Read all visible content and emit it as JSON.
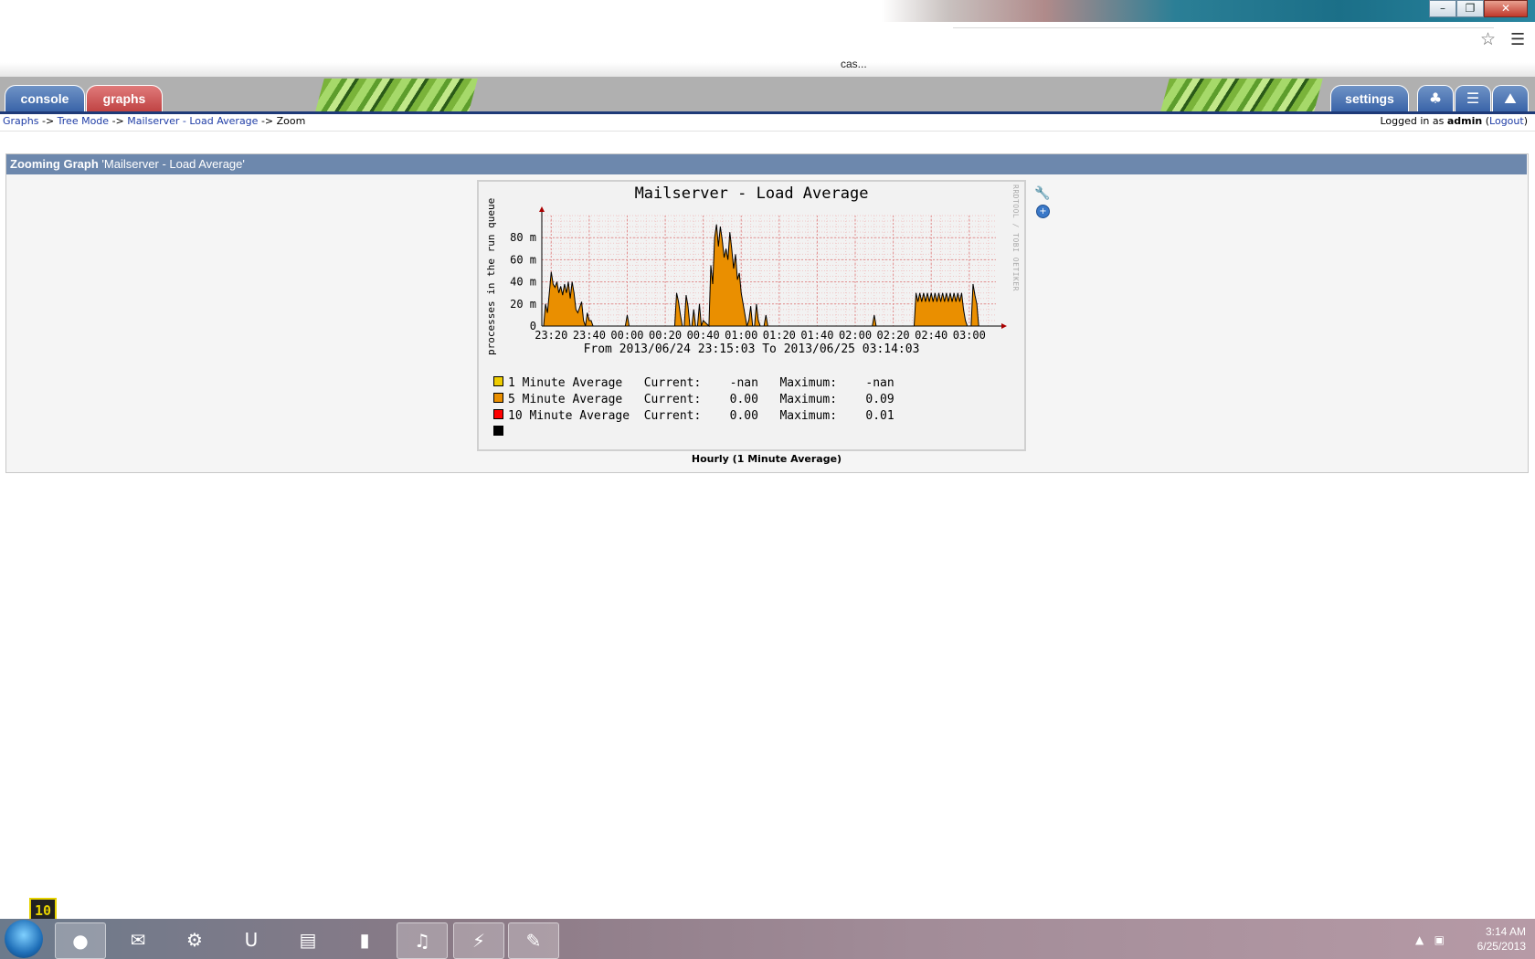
{
  "browser": {
    "tab_text": "cas...",
    "star_icon": "star-icon",
    "menu_icon": "hamburger-menu-icon",
    "window_controls": {
      "minimize": "–",
      "restore": "❐",
      "close": "✕"
    }
  },
  "nav": {
    "tabs": {
      "console": "console",
      "graphs": "graphs",
      "settings": "settings"
    },
    "icon_tabs": [
      "tree-view-icon",
      "list-view-icon",
      "preview-icon"
    ]
  },
  "breadcrumb": {
    "items": [
      "Graphs",
      "Tree Mode",
      "Mailserver - Load Average"
    ],
    "separator": "->",
    "current": "Zoom"
  },
  "login": {
    "prefix": "Logged in as",
    "user": "admin",
    "logout": "Logout"
  },
  "panel": {
    "title_bold": "Zooming Graph",
    "title_rest": "'Mailserver - Load Average'"
  },
  "graph": {
    "title": "Mailserver - Load Average",
    "ylabel": "processes in the run queue",
    "watermark": "RRDTOOL / TOBI OETIKER",
    "range_text": "From 2013/06/24 23:15:03 To 2013/06/25 03:14:03",
    "caption": "Hourly (1 Minute Average)",
    "legend": [
      {
        "name": "1 Minute Average",
        "color": "#eecc00",
        "current_label": "Current:",
        "current": "-nan",
        "max_label": "Maximum:",
        "max": "-nan"
      },
      {
        "name": "5 Minute Average",
        "color": "#ea8f00",
        "current_label": "Current:",
        "current": "0.00",
        "max_label": "Maximum:",
        "max": "0.09"
      },
      {
        "name": "10 Minute Average",
        "color": "#ff0000",
        "current_label": "Current:",
        "current": "0.00",
        "max_label": "Maximum:",
        "max": "0.01"
      },
      {
        "name": "",
        "color": "#000000",
        "current_label": "",
        "current": "",
        "max_label": "",
        "max": ""
      }
    ]
  },
  "chart_data": {
    "type": "area",
    "title": "Mailserver - Load Average",
    "ylabel": "processes in the run queue",
    "xlabel": "",
    "x_ticks": [
      "23:20",
      "23:40",
      "00:00",
      "00:20",
      "00:40",
      "01:00",
      "01:20",
      "01:40",
      "02:00",
      "02:20",
      "02:40",
      "03:00"
    ],
    "y_ticks": [
      "0",
      "20 m",
      "40 m",
      "60 m",
      "80 m"
    ],
    "ylim": [
      0,
      100
    ],
    "grid": true,
    "series": [
      {
        "name": "5 Minute Average",
        "x": [
          "23:16",
          "23:17",
          "23:18",
          "23:19",
          "23:20",
          "23:21",
          "23:22",
          "23:23",
          "23:24",
          "23:25",
          "23:26",
          "23:27",
          "23:28",
          "23:29",
          "23:30",
          "23:31",
          "23:32",
          "23:33",
          "23:34",
          "23:36",
          "23:37",
          "23:38",
          "23:39",
          "23:40",
          "23:41",
          "23:42",
          "23:59",
          "24:00",
          "24:01",
          "24:25",
          "24:26",
          "24:27",
          "24:28",
          "24:29",
          "24:30",
          "24:31",
          "24:32",
          "24:33",
          "24:34",
          "24:35",
          "24:36",
          "24:37",
          "24:38",
          "24:39",
          "24:40",
          "24:43",
          "24:44",
          "24:45",
          "24:46",
          "24:47",
          "24:48",
          "24:49",
          "24:50",
          "24:51",
          "24:52",
          "24:53",
          "24:54",
          "24:55",
          "24:56",
          "24:57",
          "24:58",
          "24:59",
          "25:00",
          "25:01",
          "25:02",
          "25:03",
          "25:04",
          "25:05",
          "25:06",
          "25:07",
          "25:08",
          "25:09",
          "25:10",
          "25:11",
          "25:12",
          "25:13",
          "25:14",
          "25:15",
          "25:16",
          "25:17",
          "25:18",
          "25:19",
          "25:20",
          "25:21",
          "25:22",
          "25:23",
          "25:24",
          "25:25",
          "25:26",
          "25:27",
          "25:28",
          "25:29",
          "25:30",
          "25:31",
          "25:32",
          "25:33",
          "25:34",
          "25:35",
          "25:36",
          "25:37",
          "25:38",
          "25:40",
          "25:41",
          "25:42",
          "25:43",
          "25:44",
          "25:45",
          "26:09",
          "26:10",
          "26:11",
          "26:12",
          "26:31",
          "26:32",
          "26:33",
          "26:34",
          "26:35",
          "26:36",
          "26:37",
          "26:38",
          "26:39",
          "26:40",
          "26:41",
          "26:42",
          "26:43",
          "26:44",
          "26:45",
          "26:46",
          "26:47",
          "26:48",
          "26:49",
          "26:50",
          "26:51",
          "26:52",
          "26:53",
          "26:54",
          "26:55",
          "26:56",
          "26:57",
          "26:58",
          "26:59",
          "27:00",
          "27:01",
          "27:02",
          "27:03",
          "27:04",
          "27:05",
          "27:06",
          "27:07",
          "27:08",
          "27:09",
          "27:10",
          "27:11",
          "27:12",
          "27:13",
          "27:14"
        ],
        "values": [
          0,
          20,
          12,
          30,
          49,
          38,
          35,
          40,
          30,
          36,
          28,
          38,
          30,
          40,
          25,
          40,
          30,
          15,
          12,
          22,
          5,
          0,
          12,
          5,
          5,
          0,
          0,
          10,
          0,
          0,
          30,
          22,
          10,
          0,
          0,
          28,
          18,
          0,
          0,
          15,
          0,
          0,
          20,
          0,
          5,
          0,
          55,
          38,
          80,
          92,
          72,
          90,
          78,
          62,
          70,
          60,
          85,
          70,
          52,
          65,
          42,
          48,
          30,
          20,
          10,
          0,
          5,
          18,
          0,
          0,
          20,
          5,
          0,
          0,
          0,
          10,
          0,
          0,
          0,
          0,
          0,
          0,
          0,
          0,
          0,
          0,
          0,
          0,
          0,
          0,
          0,
          0,
          0,
          0,
          0,
          0,
          0,
          0,
          0,
          0,
          0,
          0,
          0,
          0,
          0,
          0,
          0,
          0,
          10,
          0,
          0,
          0,
          30,
          22,
          30,
          22,
          30,
          22,
          30,
          22,
          30,
          22,
          30,
          22,
          30,
          22,
          30,
          22,
          30,
          22,
          30,
          22,
          30,
          22,
          30,
          22,
          30,
          15,
          5,
          0,
          0,
          0,
          38,
          28,
          20,
          0,
          0,
          0,
          0,
          0,
          0,
          0,
          0,
          0,
          0
        ]
      }
    ]
  },
  "taskbar": {
    "apps": [
      "windows-start-icon",
      "chrome-icon",
      "thunderbird-icon",
      "steam-icon",
      "uplay-icon",
      "file-explorer-icon",
      "command-prompt-icon",
      "itunes-icon",
      "network-tool-icon",
      "paint-icon"
    ],
    "time": "3:14 AM",
    "date": "6/25/2013",
    "badge": "10"
  }
}
